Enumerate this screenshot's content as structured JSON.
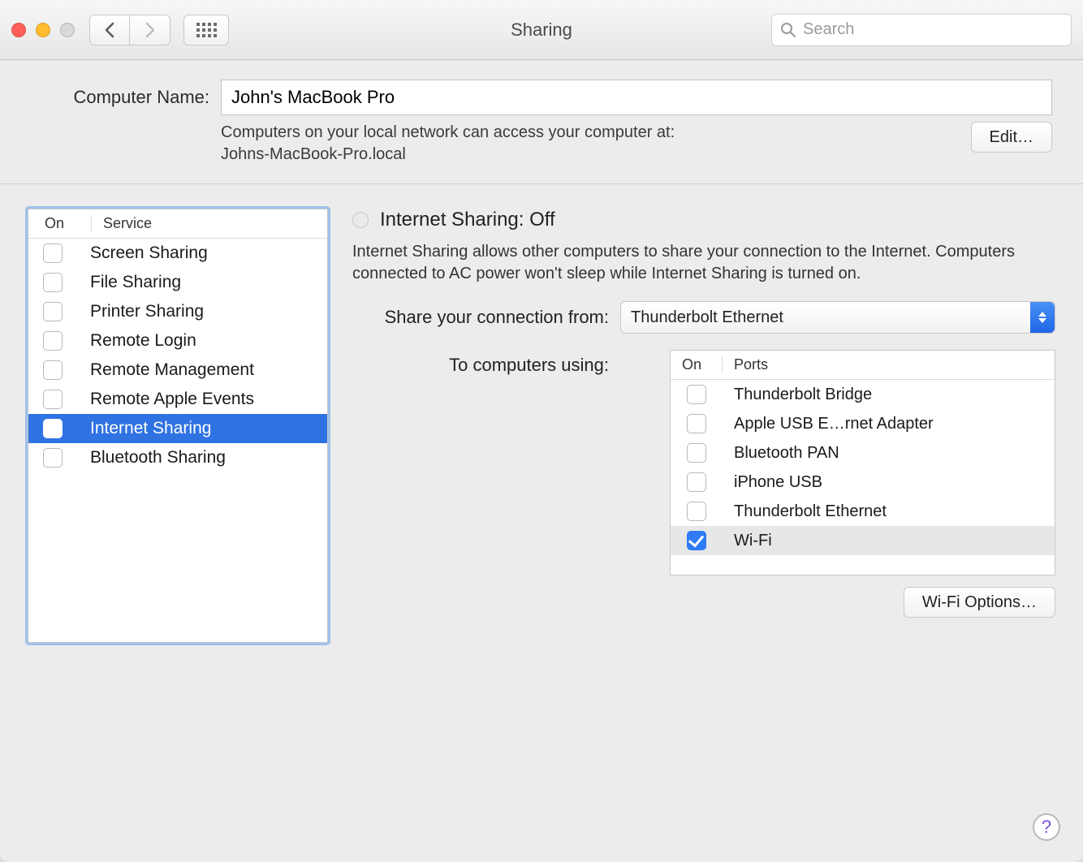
{
  "window": {
    "title": "Sharing"
  },
  "toolbar": {
    "search_placeholder": "Search"
  },
  "computer_name": {
    "label": "Computer Name:",
    "value": "John's MacBook Pro",
    "subtext_line1": "Computers on your local network can access your computer at:",
    "subtext_line2": "Johns-MacBook-Pro.local",
    "edit_label": "Edit…"
  },
  "services": {
    "header_on": "On",
    "header_service": "Service",
    "items": [
      {
        "label": "Screen Sharing",
        "on": false,
        "selected": false
      },
      {
        "label": "File Sharing",
        "on": false,
        "selected": false
      },
      {
        "label": "Printer Sharing",
        "on": false,
        "selected": false
      },
      {
        "label": "Remote Login",
        "on": false,
        "selected": false
      },
      {
        "label": "Remote Management",
        "on": false,
        "selected": false
      },
      {
        "label": "Remote Apple Events",
        "on": false,
        "selected": false
      },
      {
        "label": "Internet Sharing",
        "on": false,
        "selected": true
      },
      {
        "label": "Bluetooth Sharing",
        "on": false,
        "selected": false
      }
    ]
  },
  "detail": {
    "status_title": "Internet Sharing: Off",
    "description": "Internet Sharing allows other computers to share your connection to the Internet. Computers connected to AC power won't sleep while Internet Sharing is turned on.",
    "share_from_label": "Share your connection from:",
    "share_from_value": "Thunderbolt Ethernet",
    "to_label": "To computers using:",
    "ports_header_on": "On",
    "ports_header_ports": "Ports",
    "ports": [
      {
        "label": "Thunderbolt Bridge",
        "on": false,
        "selected": false
      },
      {
        "label": "Apple USB E…rnet Adapter",
        "on": false,
        "selected": false
      },
      {
        "label": "Bluetooth PAN",
        "on": false,
        "selected": false
      },
      {
        "label": "iPhone USB",
        "on": false,
        "selected": false
      },
      {
        "label": "Thunderbolt Ethernet",
        "on": false,
        "selected": false
      },
      {
        "label": "Wi-Fi",
        "on": true,
        "selected": true
      }
    ],
    "wifi_options_label": "Wi-Fi Options…"
  },
  "help_label": "?"
}
